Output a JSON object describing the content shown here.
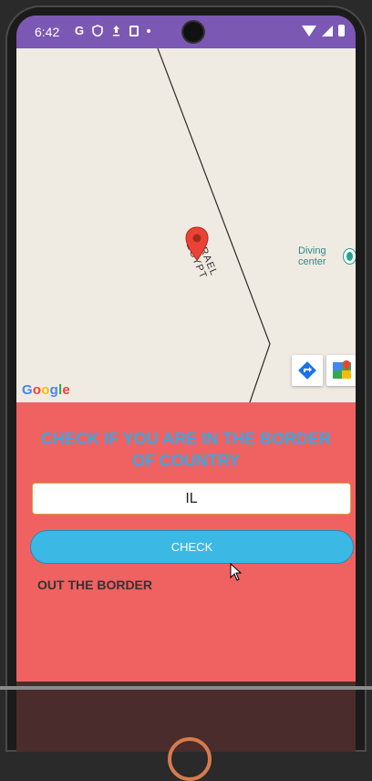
{
  "status_bar": {
    "time": "6:42",
    "left_icons": [
      "google-icon",
      "shield-icon",
      "upload-icon",
      "sd-card-icon",
      "dot-icon"
    ],
    "right_icons": [
      "wifi-icon",
      "signal-icon",
      "battery-icon"
    ],
    "google_glyph": "G",
    "colors": {
      "background": "#7b58b4"
    }
  },
  "map": {
    "border_label_top": "ISRAEL",
    "border_label_bottom": "EGYPT",
    "poi_label": "Diving center",
    "logo_text": "Google",
    "controls": [
      "directions-icon",
      "google-maps-icon"
    ],
    "colors": {
      "land": "#f0ebe2",
      "pin": "#ea4335",
      "poi": "#22a58c"
    }
  },
  "panel": {
    "title": "CHECK IF YOU ARE IN THE BORDER OF COUNTRY",
    "input_value": "IL",
    "check_label": "CHECK",
    "result": "OUT THE BORDER",
    "colors": {
      "background": "#f06161",
      "title": "#3aa8e0",
      "button": "#3cb8e5"
    }
  }
}
